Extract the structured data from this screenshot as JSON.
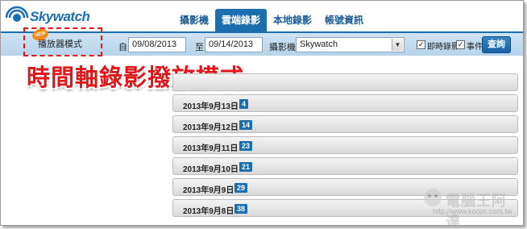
{
  "app": {
    "logo_text": "Skywatch"
  },
  "nav": {
    "tabs": [
      {
        "label": "攝影機"
      },
      {
        "label": "雲端錄影"
      },
      {
        "label": "本地錄影"
      },
      {
        "label": "帳號資訊"
      }
    ],
    "active_index": 1
  },
  "mode": {
    "badge": "NEW",
    "label": "播放器模式"
  },
  "filter": {
    "from_label": "自:",
    "from_value": "09/08/2013",
    "to_label": "至:",
    "to_value": "09/14/2013",
    "camera_label": "攝影機:",
    "camera_value": "Skywatch",
    "cb_realtime": "即時錄影",
    "cb_event": "事件",
    "query_label": "查詢"
  },
  "overlay_title": "時間軸錄影撥放模式",
  "recordings": [
    {
      "date": "",
      "count": ""
    },
    {
      "date": "2013年9月13日",
      "count": "4"
    },
    {
      "date": "2013年9月12日",
      "count": "14"
    },
    {
      "date": "2013年9月11日",
      "count": "23"
    },
    {
      "date": "2013年9月10日",
      "count": "21"
    },
    {
      "date": "2013年9月9日",
      "count": "29"
    },
    {
      "date": "2013年9月8日",
      "count": "38"
    }
  ],
  "watermark": {
    "title": "電腦王阿達",
    "url": "http://www.kocpc.com.tw"
  },
  "colors": {
    "brand_blue": "#1c6fae",
    "highlight_red": "#e0161b",
    "badge_orange": "#f08a1c"
  }
}
